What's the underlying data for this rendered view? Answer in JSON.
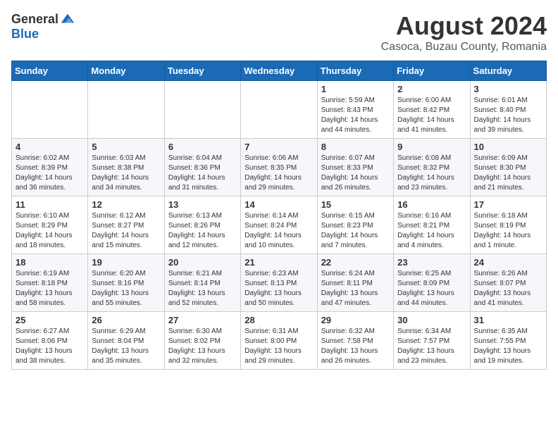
{
  "logo": {
    "general": "General",
    "blue": "Blue"
  },
  "header": {
    "month": "August 2024",
    "location": "Casoca, Buzau County, Romania"
  },
  "weekdays": [
    "Sunday",
    "Monday",
    "Tuesday",
    "Wednesday",
    "Thursday",
    "Friday",
    "Saturday"
  ],
  "weeks": [
    [
      {
        "day": "",
        "info": ""
      },
      {
        "day": "",
        "info": ""
      },
      {
        "day": "",
        "info": ""
      },
      {
        "day": "",
        "info": ""
      },
      {
        "day": "1",
        "info": "Sunrise: 5:59 AM\nSunset: 8:43 PM\nDaylight: 14 hours\nand 44 minutes."
      },
      {
        "day": "2",
        "info": "Sunrise: 6:00 AM\nSunset: 8:42 PM\nDaylight: 14 hours\nand 41 minutes."
      },
      {
        "day": "3",
        "info": "Sunrise: 6:01 AM\nSunset: 8:40 PM\nDaylight: 14 hours\nand 39 minutes."
      }
    ],
    [
      {
        "day": "4",
        "info": "Sunrise: 6:02 AM\nSunset: 8:39 PM\nDaylight: 14 hours\nand 36 minutes."
      },
      {
        "day": "5",
        "info": "Sunrise: 6:03 AM\nSunset: 8:38 PM\nDaylight: 14 hours\nand 34 minutes."
      },
      {
        "day": "6",
        "info": "Sunrise: 6:04 AM\nSunset: 8:36 PM\nDaylight: 14 hours\nand 31 minutes."
      },
      {
        "day": "7",
        "info": "Sunrise: 6:06 AM\nSunset: 8:35 PM\nDaylight: 14 hours\nand 29 minutes."
      },
      {
        "day": "8",
        "info": "Sunrise: 6:07 AM\nSunset: 8:33 PM\nDaylight: 14 hours\nand 26 minutes."
      },
      {
        "day": "9",
        "info": "Sunrise: 6:08 AM\nSunset: 8:32 PM\nDaylight: 14 hours\nand 23 minutes."
      },
      {
        "day": "10",
        "info": "Sunrise: 6:09 AM\nSunset: 8:30 PM\nDaylight: 14 hours\nand 21 minutes."
      }
    ],
    [
      {
        "day": "11",
        "info": "Sunrise: 6:10 AM\nSunset: 8:29 PM\nDaylight: 14 hours\nand 18 minutes."
      },
      {
        "day": "12",
        "info": "Sunrise: 6:12 AM\nSunset: 8:27 PM\nDaylight: 14 hours\nand 15 minutes."
      },
      {
        "day": "13",
        "info": "Sunrise: 6:13 AM\nSunset: 8:26 PM\nDaylight: 14 hours\nand 12 minutes."
      },
      {
        "day": "14",
        "info": "Sunrise: 6:14 AM\nSunset: 8:24 PM\nDaylight: 14 hours\nand 10 minutes."
      },
      {
        "day": "15",
        "info": "Sunrise: 6:15 AM\nSunset: 8:23 PM\nDaylight: 14 hours\nand 7 minutes."
      },
      {
        "day": "16",
        "info": "Sunrise: 6:16 AM\nSunset: 8:21 PM\nDaylight: 14 hours\nand 4 minutes."
      },
      {
        "day": "17",
        "info": "Sunrise: 6:18 AM\nSunset: 8:19 PM\nDaylight: 14 hours\nand 1 minute."
      }
    ],
    [
      {
        "day": "18",
        "info": "Sunrise: 6:19 AM\nSunset: 8:18 PM\nDaylight: 13 hours\nand 58 minutes."
      },
      {
        "day": "19",
        "info": "Sunrise: 6:20 AM\nSunset: 8:16 PM\nDaylight: 13 hours\nand 55 minutes."
      },
      {
        "day": "20",
        "info": "Sunrise: 6:21 AM\nSunset: 8:14 PM\nDaylight: 13 hours\nand 52 minutes."
      },
      {
        "day": "21",
        "info": "Sunrise: 6:23 AM\nSunset: 8:13 PM\nDaylight: 13 hours\nand 50 minutes."
      },
      {
        "day": "22",
        "info": "Sunrise: 6:24 AM\nSunset: 8:11 PM\nDaylight: 13 hours\nand 47 minutes."
      },
      {
        "day": "23",
        "info": "Sunrise: 6:25 AM\nSunset: 8:09 PM\nDaylight: 13 hours\nand 44 minutes."
      },
      {
        "day": "24",
        "info": "Sunrise: 6:26 AM\nSunset: 8:07 PM\nDaylight: 13 hours\nand 41 minutes."
      }
    ],
    [
      {
        "day": "25",
        "info": "Sunrise: 6:27 AM\nSunset: 8:06 PM\nDaylight: 13 hours\nand 38 minutes."
      },
      {
        "day": "26",
        "info": "Sunrise: 6:29 AM\nSunset: 8:04 PM\nDaylight: 13 hours\nand 35 minutes."
      },
      {
        "day": "27",
        "info": "Sunrise: 6:30 AM\nSunset: 8:02 PM\nDaylight: 13 hours\nand 32 minutes."
      },
      {
        "day": "28",
        "info": "Sunrise: 6:31 AM\nSunset: 8:00 PM\nDaylight: 13 hours\nand 29 minutes."
      },
      {
        "day": "29",
        "info": "Sunrise: 6:32 AM\nSunset: 7:58 PM\nDaylight: 13 hours\nand 26 minutes."
      },
      {
        "day": "30",
        "info": "Sunrise: 6:34 AM\nSunset: 7:57 PM\nDaylight: 13 hours\nand 23 minutes."
      },
      {
        "day": "31",
        "info": "Sunrise: 6:35 AM\nSunset: 7:55 PM\nDaylight: 13 hours\nand 19 minutes."
      }
    ]
  ]
}
